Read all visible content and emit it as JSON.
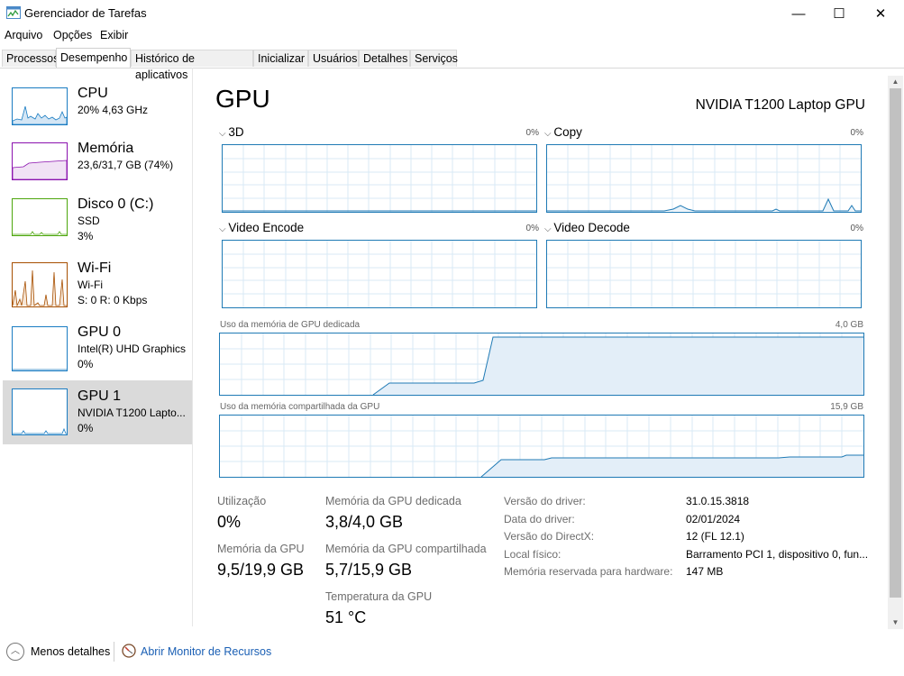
{
  "window": {
    "title": "Gerenciador de Tarefas",
    "minimize_glyph": "—",
    "maximize_glyph": "☐",
    "close_glyph": "✕"
  },
  "menu": [
    "Arquivo",
    "Opções",
    "Exibir"
  ],
  "tabs": [
    "Processos",
    "Desempenho",
    "Histórico de aplicativos",
    "Inicializar",
    "Usuários",
    "Detalhes",
    "Serviços"
  ],
  "active_tab": "Desempenho",
  "sidebar": {
    "items": [
      {
        "title": "CPU",
        "line1": "20% 4,63 GHz",
        "line2": "",
        "color": "#1a7cc2",
        "icon": "cpu-graph"
      },
      {
        "title": "Memória",
        "line1": "23,6/31,7 GB (74%)",
        "line2": "",
        "color": "#8b12ae",
        "icon": "memory-graph"
      },
      {
        "title": "Disco 0 (C:)",
        "line1": "SSD",
        "line2": "3%",
        "color": "#4da60c",
        "icon": "disk-graph"
      },
      {
        "title": "Wi-Fi",
        "line1": "Wi-Fi",
        "line2": "S: 0 R: 0 Kbps",
        "color": "#a74f01",
        "icon": "network-graph"
      },
      {
        "title": "GPU 0",
        "line1": "Intel(R) UHD Graphics",
        "line2": "0%",
        "color": "#1a7cc2",
        "icon": "gpu-graph"
      },
      {
        "title": "GPU 1",
        "line1": "NVIDIA T1200 Lapto...",
        "line2": "0%",
        "color": "#1a7cc2",
        "icon": "gpu-graph"
      }
    ]
  },
  "main": {
    "title": "GPU",
    "model": "NVIDIA T1200 Laptop GPU",
    "engines": [
      {
        "label": "3D",
        "percent": "0%"
      },
      {
        "label": "Copy",
        "percent": "0%"
      },
      {
        "label": "Video Encode",
        "percent": "0%"
      },
      {
        "label": "Video Decode",
        "percent": "0%"
      }
    ],
    "dedicated_memory": {
      "label": "Uso da memória de GPU dedicada",
      "max": "4,0 GB"
    },
    "shared_memory": {
      "label": "Uso da memória compartilhada da GPU",
      "max": "15,9 GB"
    },
    "stats": {
      "utilization_label": "Utilização",
      "utilization_value": "0%",
      "gpu_memory_label": "Memória da GPU",
      "gpu_memory_value": "9,5/19,9 GB",
      "dedicated_label": "Memória da GPU dedicada",
      "dedicated_value": "3,8/4,0 GB",
      "shared_label": "Memória da GPU compartilhada",
      "shared_value": "5,7/15,9 GB",
      "temp_label": "Temperatura da GPU",
      "temp_value": "51 °C"
    },
    "info": [
      {
        "label": "Versão do driver:",
        "value": "31.0.15.3818"
      },
      {
        "label": "Data do driver:",
        "value": "02/01/2024"
      },
      {
        "label": "Versão do DirectX:",
        "value": "12 (FL 12.1)"
      },
      {
        "label": "Local físico:",
        "value": "Barramento PCI 1, dispositivo 0, fun..."
      },
      {
        "label": "Memória reservada para hardware:",
        "value": "147 MB"
      }
    ]
  },
  "footer": {
    "less_details": "Menos detalhes",
    "open_monitor": "Abrir Monitor de Recursos"
  },
  "colors": {
    "accent": "#1a7cc2",
    "graph_border": "#1f7ab5",
    "link": "#1a5fb4"
  }
}
